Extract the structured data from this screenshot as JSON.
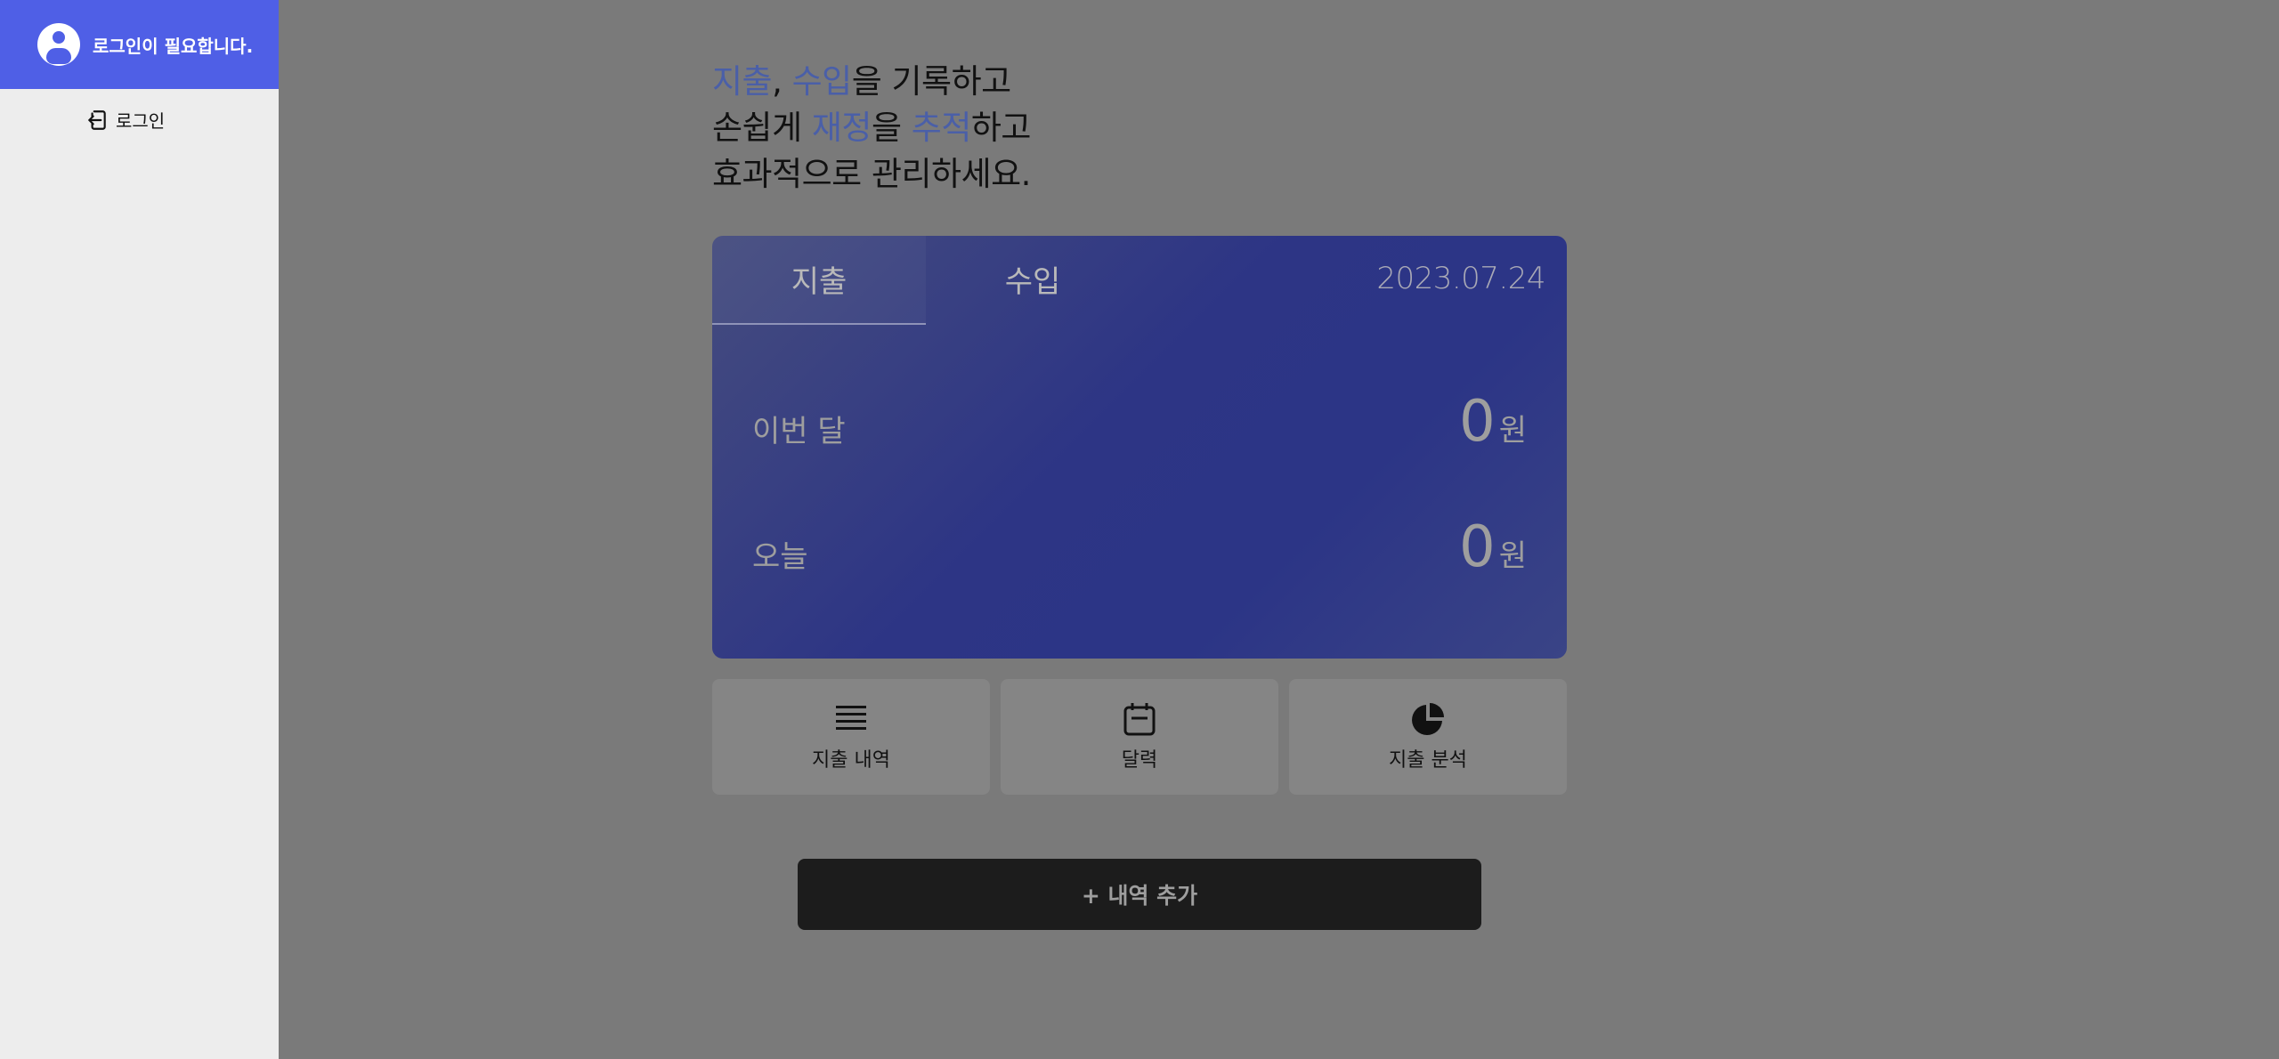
{
  "sidebar": {
    "login_needed": "로그인이 필요합니다.",
    "login_label": "로그인"
  },
  "headline": {
    "line1": [
      "지출",
      ", ",
      "수입",
      "을 기록하고"
    ],
    "line2": [
      "손쉽게 ",
      "재정",
      "을 ",
      "추적",
      "하고"
    ],
    "line3": "효과적으로 관리하세요."
  },
  "card": {
    "tab_expense": "지출",
    "tab_income": "수입",
    "date": "2023.07.24",
    "rows": [
      {
        "label": "이번 달",
        "value": "0",
        "unit": "원"
      },
      {
        "label": "오늘",
        "value": "0",
        "unit": "원"
      }
    ]
  },
  "quick": [
    {
      "label": "지출 내역",
      "icon": "list-icon"
    },
    {
      "label": "달력",
      "icon": "calendar-icon"
    },
    {
      "label": "지출 분석",
      "icon": "pie-chart-icon"
    }
  ],
  "add_button": "+ 내역 추가",
  "colors": {
    "accent": "#4f5fe6",
    "highlight": "#4a5fa8",
    "card_bg": "#2d3585"
  }
}
